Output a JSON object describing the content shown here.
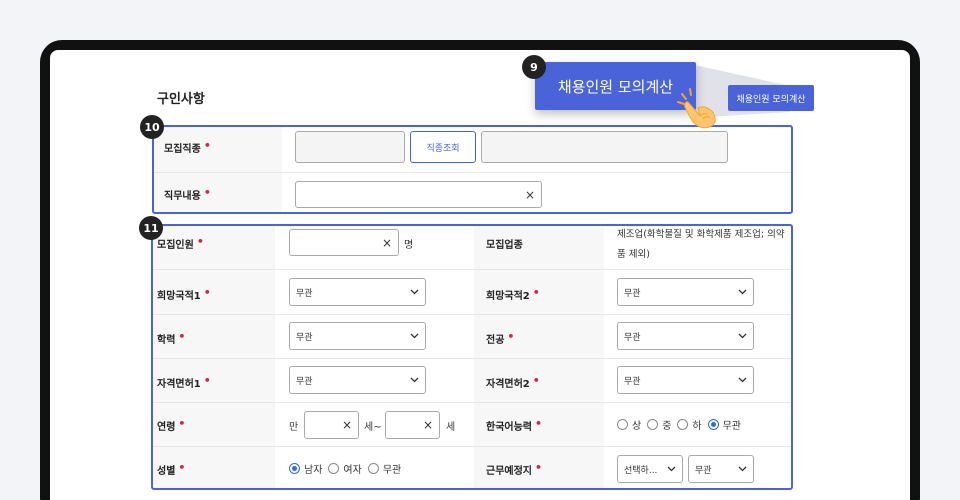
{
  "page": {
    "section_title": "구인사항"
  },
  "callout": {
    "main_button": "채용인원 모의계산",
    "small_button": "채용인원 모의계산",
    "badge_9": "9"
  },
  "box10": {
    "badge": "10",
    "row1": {
      "label": "모집직종",
      "lookup_button": "직종조회"
    },
    "row2": {
      "label": "직무내용",
      "clear": "×"
    }
  },
  "box11": {
    "badge": "11",
    "headcount": {
      "label": "모집인원",
      "clear": "×",
      "unit": "명"
    },
    "industry": {
      "label": "모집업종",
      "value_line1": "제조업(화학물질 및 화학제품 제조업; 의약",
      "value_line2": "품 제외)"
    },
    "nationality1": {
      "label": "희망국적1",
      "value": "무관"
    },
    "nationality2": {
      "label": "희망국적2",
      "value": "무관"
    },
    "education": {
      "label": "학력",
      "value": "무관"
    },
    "major": {
      "label": "전공",
      "value": "무관"
    },
    "license1": {
      "label": "자격면허1",
      "value": "무관"
    },
    "license2": {
      "label": "자격면허2",
      "value": "무관"
    },
    "age": {
      "label": "연령",
      "prefix": "만",
      "clear": "×",
      "mid": "세~",
      "suffix": "세"
    },
    "korean": {
      "label": "한국어능력",
      "options": [
        "상",
        "중",
        "하",
        "무관"
      ],
      "selected": "무관"
    },
    "gender": {
      "label": "성별",
      "options": [
        "남자",
        "여자",
        "무관"
      ],
      "selected": "남자"
    },
    "workplace": {
      "label": "근무예정지",
      "select1": "선택하...",
      "select2": "무관"
    }
  },
  "colors": {
    "accent": "#4a63d9",
    "required": "#d6234a",
    "radio": "#2f6bdf"
  },
  "icons": {
    "hand": "pointing-hand-icon",
    "chevron": "chevron-down-icon"
  }
}
